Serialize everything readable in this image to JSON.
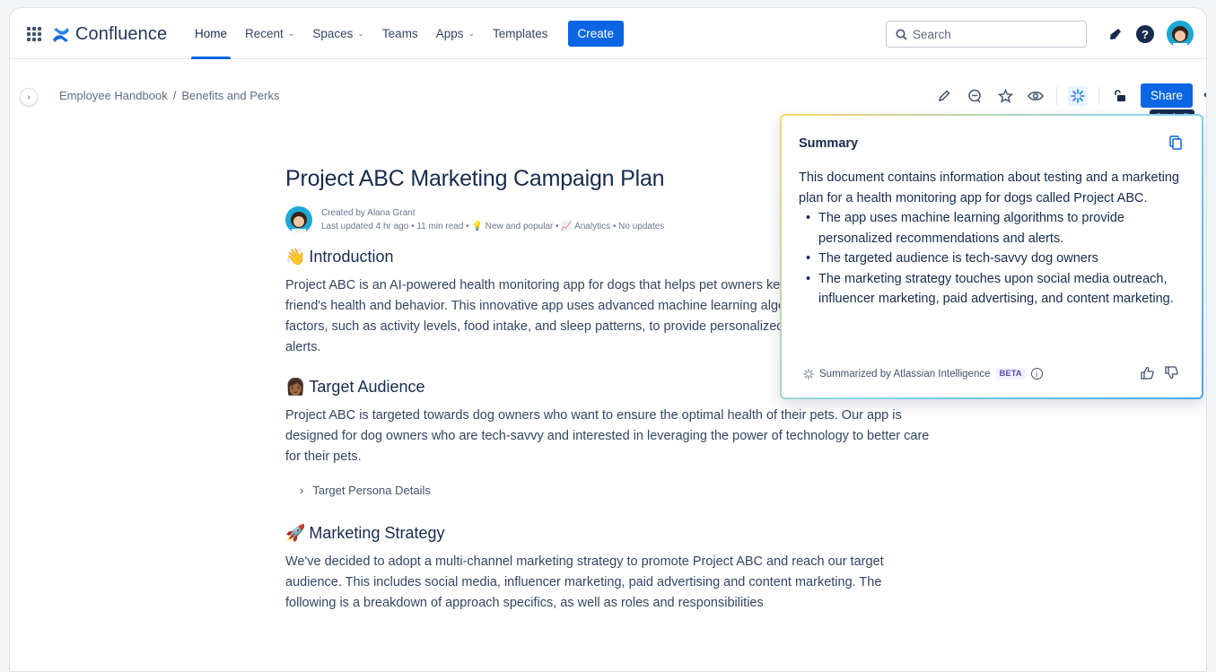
{
  "nav": {
    "brand": "Confluence",
    "items": [
      {
        "label": "Home",
        "dropdown": false,
        "active": true
      },
      {
        "label": "Recent",
        "dropdown": true
      },
      {
        "label": "Spaces",
        "dropdown": true
      },
      {
        "label": "Teams",
        "dropdown": false
      },
      {
        "label": "Apps",
        "dropdown": true
      },
      {
        "label": "Templates",
        "dropdown": false
      }
    ],
    "create_label": "Create",
    "search_placeholder": "Search",
    "chevron": "⌄"
  },
  "breadcrumb": {
    "items": [
      "Employee Handbook",
      "Benefits and Perks"
    ],
    "separator": "/"
  },
  "toolbar": {
    "share_label": "Share",
    "more": "•••",
    "tooltip": "Copied!"
  },
  "page": {
    "title": "Project ABC Marketing Campaign Plan",
    "byline_created": "Created by Alana Grant",
    "byline_meta": "Last updated 4 hr ago • 11 min read • ",
    "byline_popular": "New and popular",
    "byline_analytics": "Analytics",
    "byline_updates": "No updates",
    "sections": [
      {
        "emoji": "👋",
        "heading": "Introduction",
        "text": "Project ABC is an AI-powered health monitoring app for dogs that helps pet owners keep track of their furry friend's health and behavior. This innovative app uses advanced machine learning algorithms to analyze various factors, such as activity levels, food intake, and sleep patterns, to provide personalized recommendations and alerts."
      },
      {
        "emoji": "👩🏾",
        "heading": "Target Audience",
        "text": "Project ABC is targeted towards dog owners who want to ensure the optimal health of their pets. Our app is designed for dog owners who are tech-savvy and interested in leveraging the power of technology to better care for their pets."
      },
      {
        "emoji": "🚀",
        "heading": "Marketing Strategy",
        "text": "We've decided to adopt a multi-channel marketing strategy to promote Project ABC and reach our target audience. This includes social media, influencer marketing, paid advertising and content marketing. The following is a breakdown of approach specifics, as well as roles and responsibilities"
      }
    ],
    "expand_label": "Target Persona Details"
  },
  "summary": {
    "heading": "Summary",
    "intro": "This document contains information about testing and a marketing plan for a health monitoring app for dogs called Project ABC.",
    "bullets": [
      "The app uses machine learning algorithms to provide personalized recommendations and alerts.",
      "The targeted audience is tech-savvy dog owners",
      "The marketing strategy touches upon social media outreach, influencer marketing, paid advertising, and content marketing."
    ],
    "footer_label": "Summarized by Atlassian Intelligence",
    "beta_label": "BETA",
    "info": "i"
  },
  "colors": {
    "primary": "#0c66e4",
    "text": "#172b4d"
  }
}
